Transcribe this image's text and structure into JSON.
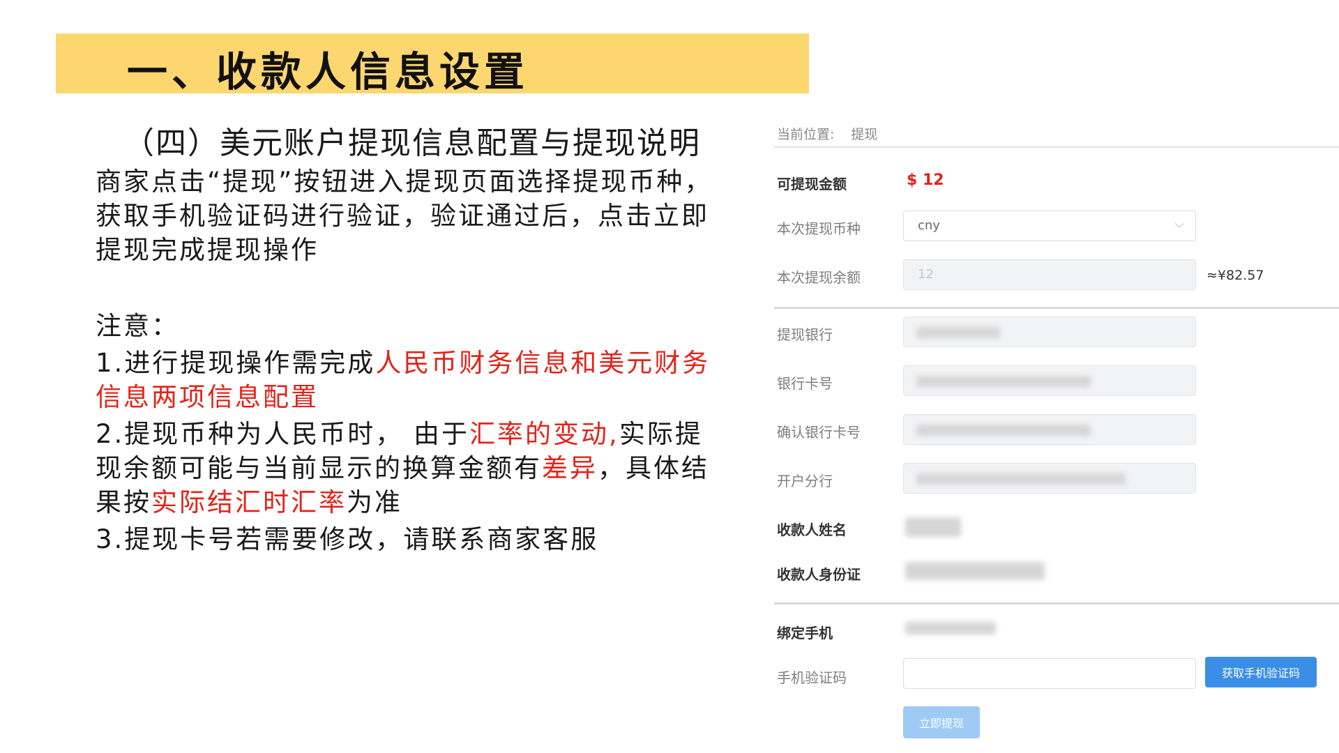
{
  "banner": {
    "title": "一、收款人信息设置"
  },
  "left": {
    "subheading": "（四）美元账户提现信息配置与提现说明",
    "paragraph": "商家点击“提现”按钮进入提现页面选择提现币种，获取手机验证码进行验证，验证通过后，点击立即提现完成提现操作",
    "notice_label": "注意：",
    "item1": {
      "prefix": "1.进行提现操作需完成",
      "red": "人民币财务信息和美元财务信息两项信息配置"
    },
    "item2": {
      "p1": "2.提现币种为人民币时， 由于",
      "r1": "汇率的变动,",
      "p2": "实际提现余额可能与当前显示的换算金额有",
      "r2": "差异",
      "p3": "，具体结果按",
      "r3": "实际结汇时汇率",
      "p4": "为准"
    },
    "item3": "3.提现卡号若需要修改，请联系商家客服"
  },
  "screenshot": {
    "breadcrumb_label": "当前位置:",
    "breadcrumb_page": "提现",
    "available_label": "可提现金额",
    "available_amount": "$ 12",
    "currency_label": "本次提现币种",
    "currency_value": "cny",
    "balance_label": "本次提现余额",
    "balance_value": "12",
    "approx_value": "≈¥82.57",
    "bank_label": "提现银行",
    "card_label": "银行卡号",
    "confirm_card_label": "确认银行卡号",
    "branch_label": "开户分行",
    "payee_name_label": "收款人姓名",
    "payee_id_label": "收款人身份证",
    "phone_label": "绑定手机",
    "sms_label": "手机验证码",
    "get_code_button": "获取手机验证码",
    "withdraw_button": "立即提现",
    "accent_color": "#3a8ee6",
    "amount_color": "#e2231a"
  }
}
